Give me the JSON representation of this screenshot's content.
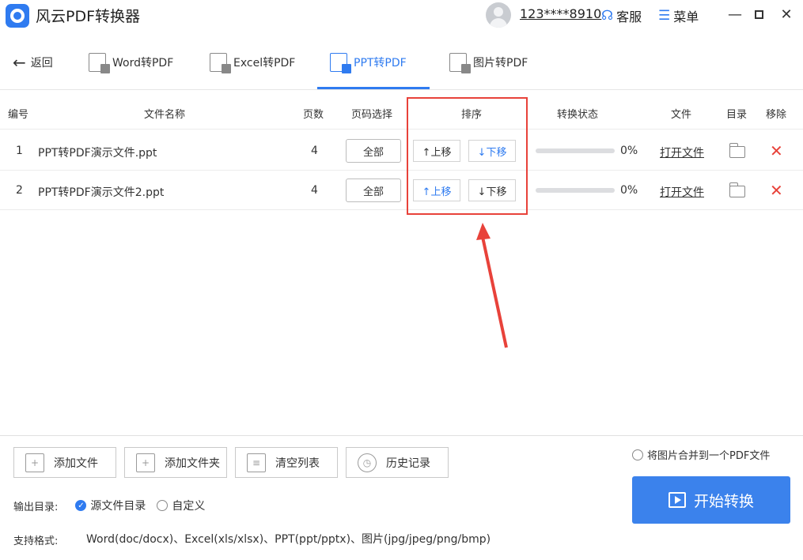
{
  "app": {
    "title": "风云PDF转换器"
  },
  "header": {
    "phone": "123****8910",
    "service_label": "客服",
    "menu_label": "菜单"
  },
  "nav": {
    "back_label": "返回",
    "tabs": [
      {
        "label": "Word转PDF",
        "active": false
      },
      {
        "label": "Excel转PDF",
        "active": false
      },
      {
        "label": "PPT转PDF",
        "active": true
      },
      {
        "label": "图片转PDF",
        "active": false
      }
    ]
  },
  "table": {
    "headers": {
      "no": "编号",
      "name": "文件名称",
      "pages": "页数",
      "page_select": "页码选择",
      "sort": "排序",
      "status": "转换状态",
      "file": "文件",
      "dir": "目录",
      "remove": "移除"
    },
    "rows": [
      {
        "no": "1",
        "name": "PPT转PDF演示文件.ppt",
        "pages": "4",
        "page_select": "全部",
        "move_up": "↑上移",
        "move_down": "↓下移",
        "progress": 0,
        "percent": "0%",
        "open": "打开文件"
      },
      {
        "no": "2",
        "name": "PPT转PDF演示文件2.ppt",
        "pages": "4",
        "page_select": "全部",
        "move_up": "↑上移",
        "move_down": "↓下移",
        "progress": 0,
        "percent": "0%",
        "open": "打开文件"
      }
    ]
  },
  "actions": {
    "add_file": "添加文件",
    "add_folder": "添加文件夹",
    "clear_list": "清空列表",
    "history": "历史记录"
  },
  "merge_option": "将图片合并到一个PDF文件",
  "output": {
    "label": "输出目录:",
    "source_dir": "源文件目录",
    "custom": "自定义",
    "selected": "source_dir"
  },
  "formats": {
    "label": "支持格式:",
    "list": "Word(doc/docx)、Excel(xls/xlsx)、PPT(ppt/pptx)、图片(jpg/jpeg/png/bmp)"
  },
  "start_label": "开始转换",
  "colors": {
    "accent": "#2f7bf0",
    "danger": "#e8423a",
    "start_button": "#3b82ec"
  }
}
